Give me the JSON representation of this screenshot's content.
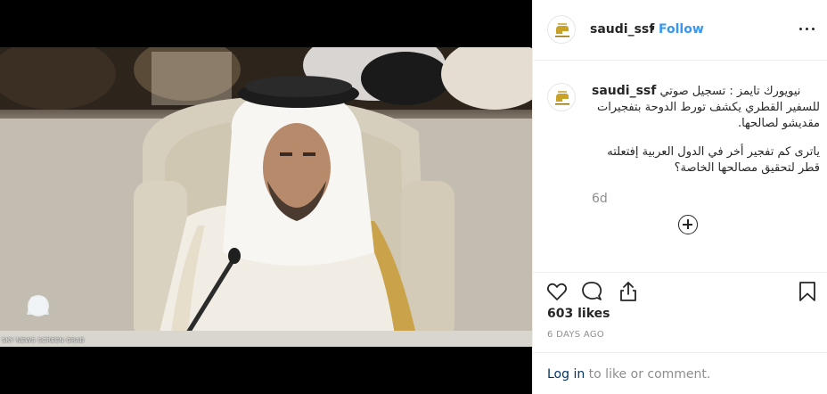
{
  "post": {
    "username": "saudi_ssf",
    "separator": "•",
    "follow_label": "Follow",
    "caption_line1": "نيويورك تايمز : تسجيل صوتي",
    "caption_line2": "للسفير القطري يكشف تورط الدوحة بتفجيرات",
    "caption_line3": "مقديشو لصالحها.",
    "caption_para2": "ياترى كم تفجير أخر في الدول العربية إفتعلته قطر لتحقيق مصالحها الخاصة؟",
    "age": "6d",
    "likes": "603 likes",
    "date": "6 DAYS AGO",
    "login_link": "Log in",
    "login_rest": " to like or comment."
  },
  "media": {
    "watermark": "SKY NEWS SCREEN GRAB"
  },
  "icons": {
    "more": "more-options-icon",
    "like": "heart-icon",
    "comment": "comment-icon",
    "share": "share-icon",
    "save": "bookmark-icon",
    "add_comment": "plus-circle-icon"
  },
  "colors": {
    "follow": "#3897f0",
    "login_link": "#003569",
    "muted": "#8e8e8e",
    "text": "#262626"
  }
}
